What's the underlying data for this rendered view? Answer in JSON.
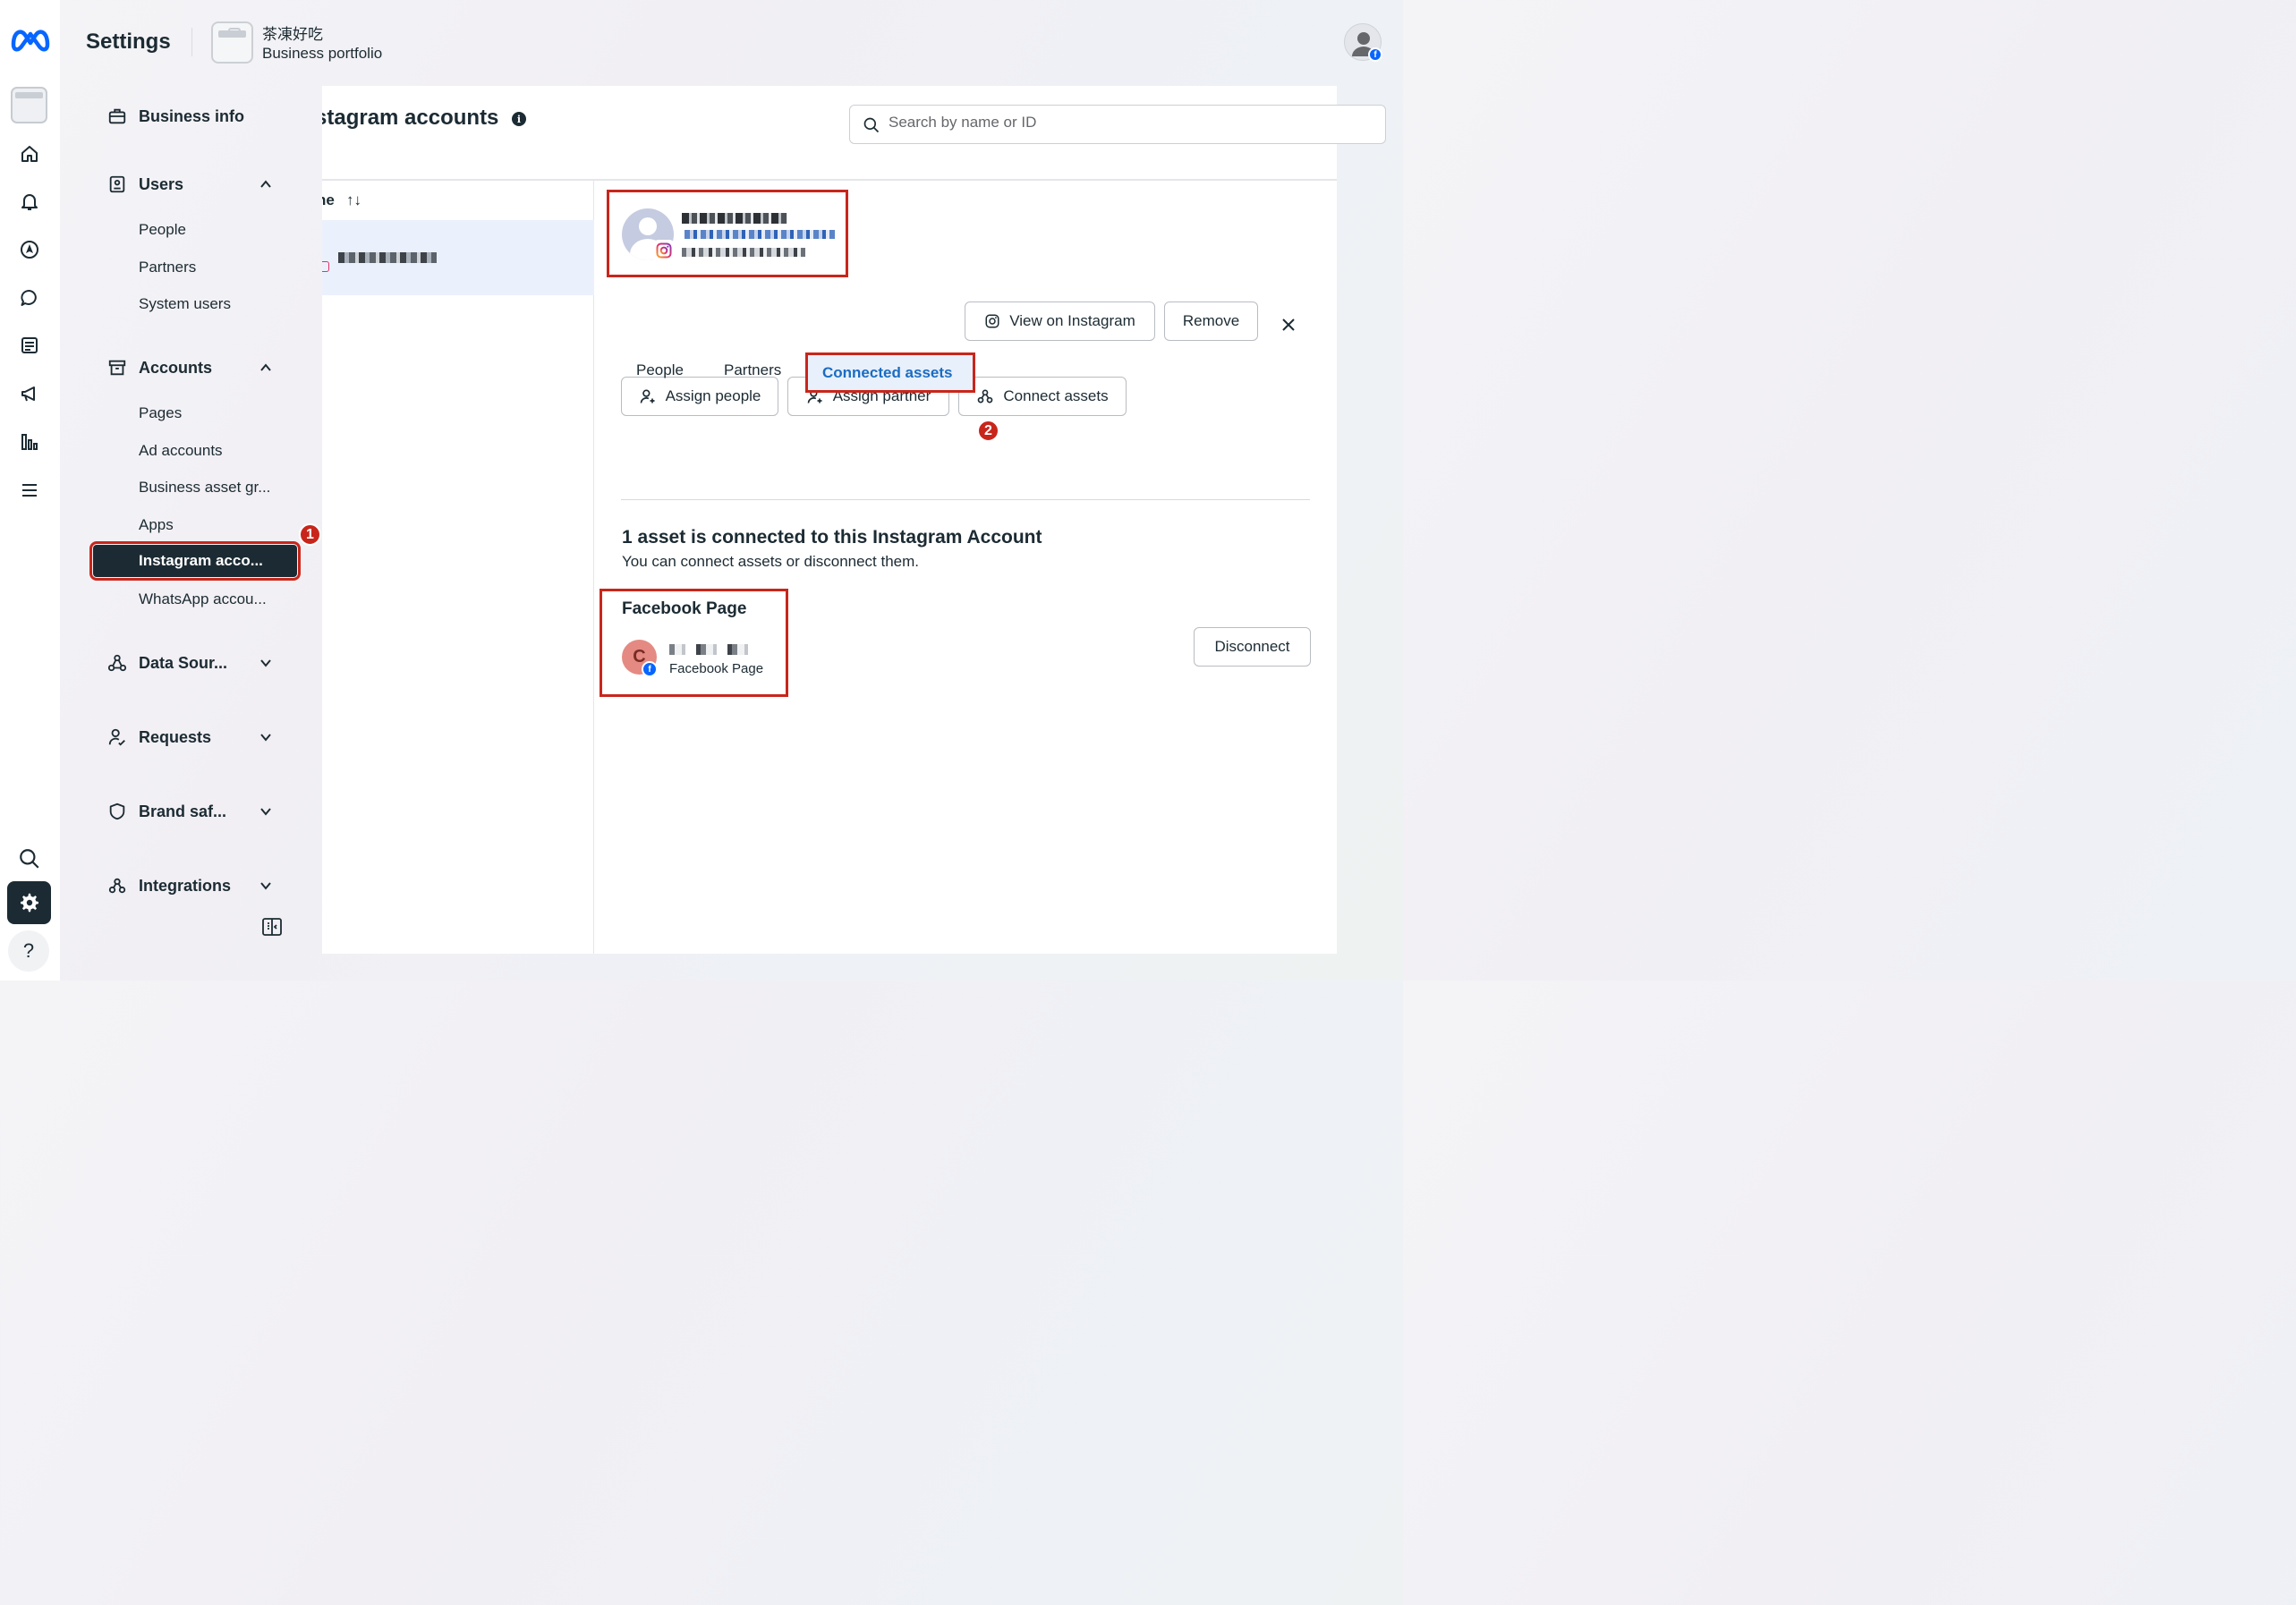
{
  "header": {
    "title": "Settings",
    "business_name": "茶凍好吃",
    "business_type": "Business portfolio"
  },
  "rail": {
    "icons": [
      "meta-logo",
      "portfolio-icon",
      "home-icon",
      "bell-icon",
      "compass-icon",
      "chat-icon",
      "content-icon",
      "megaphone-icon",
      "insights-icon",
      "menu-icon",
      "search-icon",
      "gear-icon",
      "help-icon"
    ],
    "help_glyph": "?"
  },
  "nav": {
    "business_info": "Business info",
    "users": {
      "label": "Users",
      "items": [
        "People",
        "Partners",
        "System users"
      ]
    },
    "accounts": {
      "label": "Accounts",
      "items": [
        "Pages",
        "Ad accounts",
        "Business asset gr...",
        "Apps",
        "Instagram acco...",
        "WhatsApp accou..."
      ],
      "active": "Instagram acco..."
    },
    "data_sources": "Data Sour...",
    "requests": "Requests",
    "brand_safety": "Brand saf...",
    "integrations": "Integrations"
  },
  "annotations": {
    "badge_1": "1",
    "badge_2": "2",
    "highlight_color": "#c8261b"
  },
  "main": {
    "title": "stagram accounts",
    "search_placeholder": "Search by name or ID",
    "column_header": "ne",
    "sort_glyph": "↑↓",
    "detail": {
      "buttons": {
        "view_on_instagram": "View on Instagram",
        "remove": "Remove",
        "assign_people": "Assign people",
        "assign_partner": "Assign partner",
        "connect_assets": "Connect assets"
      },
      "tabs": [
        "People",
        "Partners",
        "Connected assets"
      ],
      "active_tab": "Connected assets",
      "connected_heading": "1 asset is connected to this Instagram Account",
      "connected_sub": "You can connect assets or disconnect them.",
      "asset": {
        "section_title": "Facebook Page",
        "avatar_letter": "C",
        "type_label": "Facebook Page",
        "disconnect_label": "Disconnect"
      }
    }
  },
  "colors": {
    "accent_blue": "#1b6cc2",
    "facebook_blue": "#0866ff",
    "dark": "#1c2b33",
    "selected_row": "#ebf1fc"
  }
}
